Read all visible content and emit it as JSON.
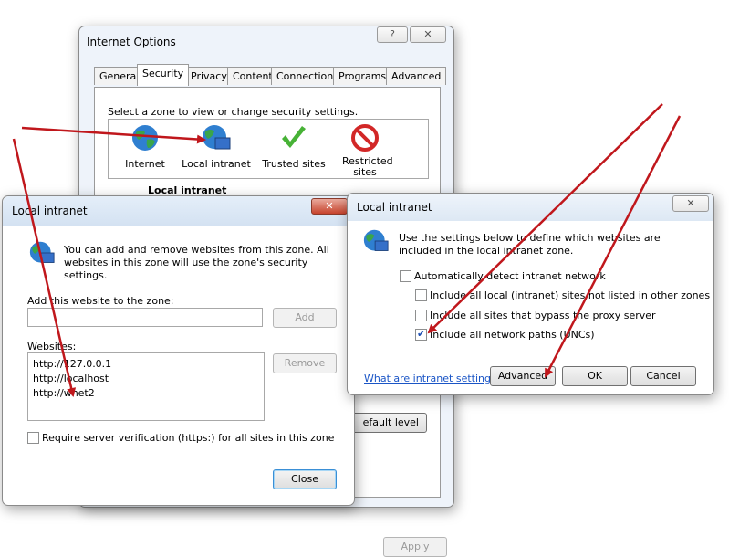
{
  "internet_options": {
    "title": "Internet Options",
    "help_glyph": "?",
    "close_glyph": "✕",
    "tabs": [
      "General",
      "Security",
      "Privacy",
      "Content",
      "Connections",
      "Programs",
      "Advanced"
    ],
    "instruction": "Select a zone to view or change security settings.",
    "zones": [
      {
        "label": "Internet",
        "icon": "globe-icon"
      },
      {
        "label": "Local intranet",
        "icon": "intranet-globe-icon"
      },
      {
        "label": "Trusted sites",
        "icon": "checkmark-icon"
      },
      {
        "label": "Restricted sites",
        "icon": "restricted-icon"
      }
    ],
    "zone_heading": "Local intranet",
    "default_level_button": "efault level",
    "apply_button": "Apply"
  },
  "local_intranet_sites": {
    "title": "Local intranet",
    "close_glyph": "✕",
    "info_text": "You can add and remove websites from this zone. All websites in this zone will use the zone's security settings.",
    "add_label": "Add this website to the zone:",
    "add_input_value": "",
    "add_button": "Add",
    "websites_label": "Websites:",
    "websites": [
      "http://127.0.0.1",
      "http://localhost",
      "http://wnet2"
    ],
    "remove_button": "Remove",
    "require_verification_label": "Require server verification (https:) for all sites in this zone",
    "require_verification_checked": false,
    "close_button": "Close"
  },
  "local_intranet_settings": {
    "title": "Local intranet",
    "close_glyph": "✕",
    "info_text": "Use the settings below to define which websites are included in the local intranet zone.",
    "auto_detect_label": "Automatically detect intranet network",
    "auto_detect_checked": false,
    "options": [
      {
        "label": "Include all local (intranet) sites not listed in other zones",
        "checked": false
      },
      {
        "label": "Include all sites that bypass the proxy server",
        "checked": false
      },
      {
        "label": "Include all network paths (UNCs)",
        "checked": true
      }
    ],
    "help_link": "What are intranet settings?",
    "advanced_button": "Advanced",
    "ok_button": "OK",
    "cancel_button": "Cancel"
  },
  "annotation_color": "#c0171c"
}
